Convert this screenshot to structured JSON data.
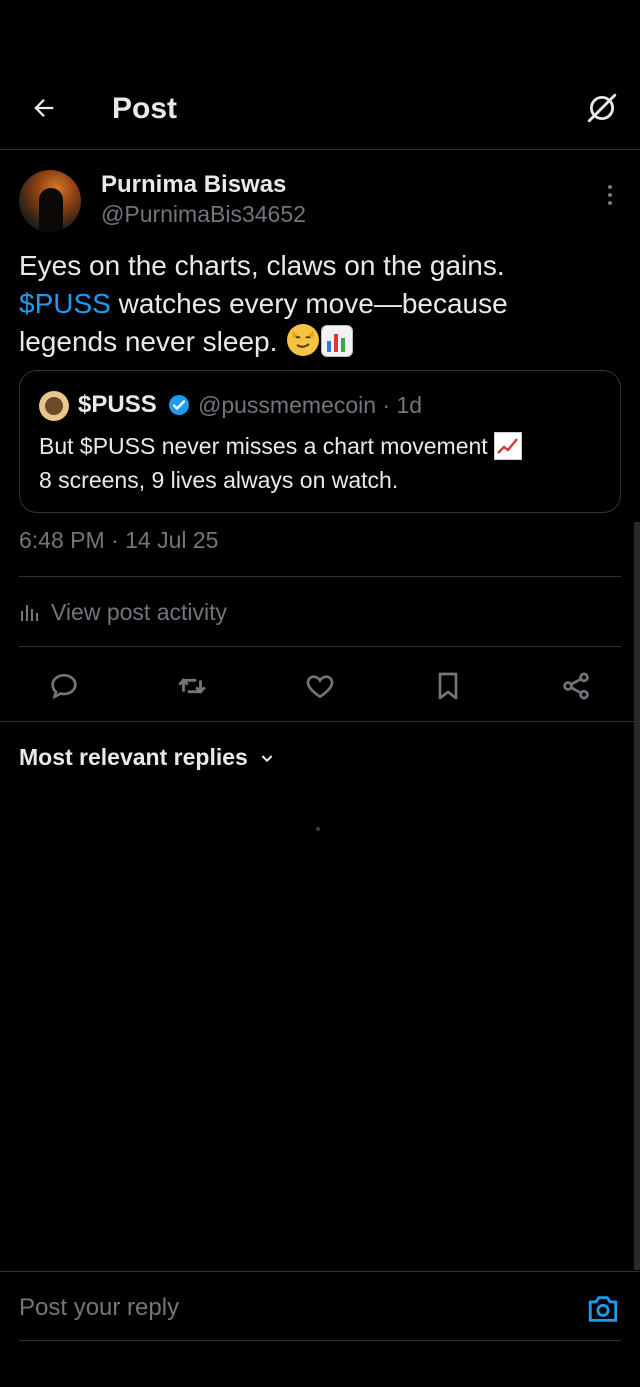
{
  "header": {
    "title": "Post"
  },
  "post": {
    "author_name": "Purnima Biswas",
    "author_handle": "@PurnimaBis34652",
    "text_line1": "Eyes on the charts, claws on the gains.",
    "text_cashtag": "$PUSS",
    "text_line2_rest": " watches every move—because",
    "text_line3": "legends never sleep. ",
    "timestamp": "6:48 PM · 14 Jul 25"
  },
  "quote": {
    "name": "$PUSS",
    "handle_time": "@pussmemecoin · 1d",
    "line1": "But $PUSS never misses a chart movement ",
    "line2": "8 screens, 9 lives always on watch."
  },
  "activity": {
    "label": "View post activity"
  },
  "replies": {
    "sort_label": "Most relevant replies"
  },
  "composer": {
    "placeholder": "Post your reply"
  },
  "colors": {
    "accent": "#1d9bf0",
    "muted": "#71767b",
    "text": "#e7e9ea",
    "border": "#2f3336",
    "background": "#000000"
  },
  "icons": {
    "back": "arrow-left-icon",
    "grok": "grok-icon",
    "more": "more-vertical-icon",
    "verified": "verified-badge-icon",
    "activity": "bar-chart-icon",
    "reply": "reply-icon",
    "repost": "repost-icon",
    "like": "heart-icon",
    "bookmark": "bookmark-icon",
    "share": "share-icon",
    "chevron": "chevron-down-icon",
    "camera": "camera-icon"
  }
}
